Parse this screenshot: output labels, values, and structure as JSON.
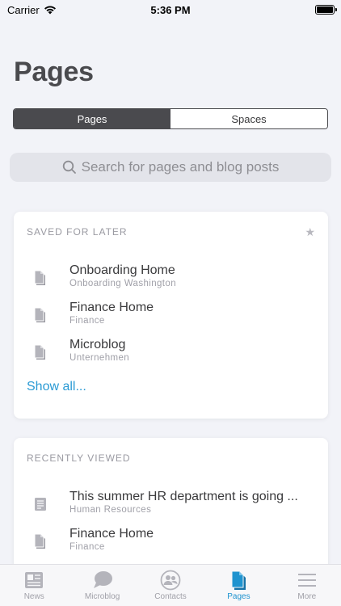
{
  "status_bar": {
    "carrier": "Carrier",
    "time": "5:36 PM"
  },
  "title": "Pages",
  "segments": [
    {
      "label": "Pages",
      "active": true
    },
    {
      "label": "Spaces",
      "active": false
    }
  ],
  "search": {
    "placeholder": "Search for pages and blog posts",
    "icon": "search-icon"
  },
  "saved_for_later": {
    "title": "SAVED FOR LATER",
    "items": [
      {
        "title": "Onboarding Home",
        "subtitle": "Onboarding Washington",
        "icon": "page-icon"
      },
      {
        "title": "Finance Home",
        "subtitle": "Finance",
        "icon": "page-icon"
      },
      {
        "title": "Microblog",
        "subtitle": "Unternehmen",
        "icon": "page-icon"
      }
    ],
    "show_all": "Show all..."
  },
  "recently_viewed": {
    "title": "RECENTLY VIEWED",
    "items": [
      {
        "title": "This summer HR department is going ...",
        "subtitle": "Human Resources",
        "icon": "blog-post-icon"
      },
      {
        "title": "Finance Home",
        "subtitle": "Finance",
        "icon": "page-icon"
      }
    ]
  },
  "tabs": [
    {
      "label": "News",
      "icon": "news-icon",
      "active": false
    },
    {
      "label": "Microblog",
      "icon": "chat-bubble-icon",
      "active": false
    },
    {
      "label": "Contacts",
      "icon": "contacts-icon",
      "active": false
    },
    {
      "label": "Pages",
      "icon": "pages-icon",
      "active": true
    },
    {
      "label": "More",
      "icon": "menu-icon",
      "active": false
    }
  ],
  "colors": {
    "accent": "#1f93cf",
    "link": "#2a9ad4",
    "segment_active": "#4a4a4e",
    "background": "#f2f3f8"
  }
}
